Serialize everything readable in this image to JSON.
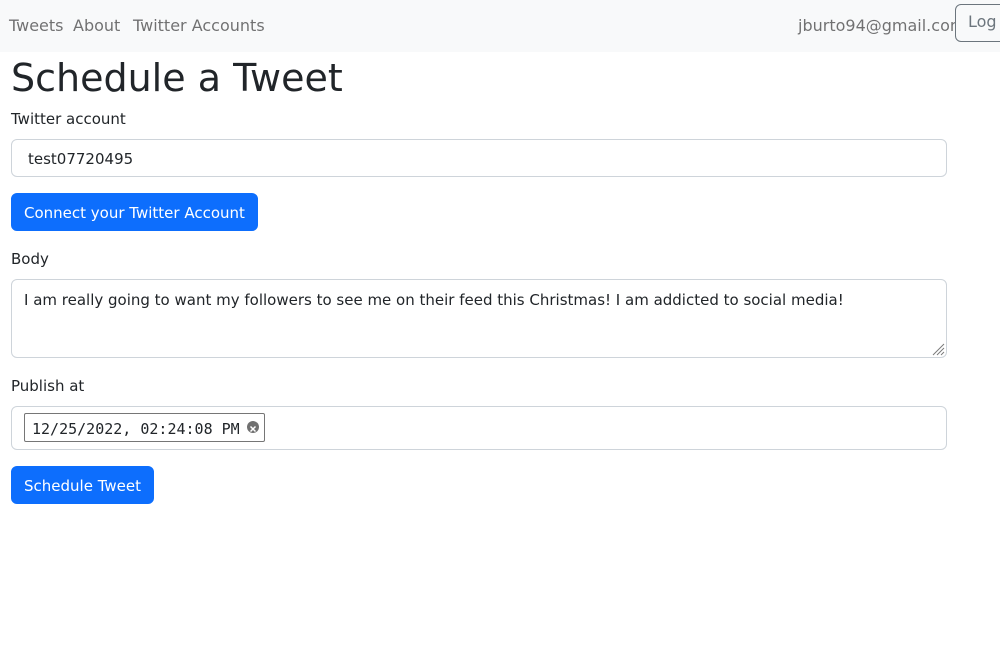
{
  "nav": {
    "links": [
      "Tweets",
      "About",
      "Twitter Accounts"
    ],
    "email": "jburto94@gmail.com",
    "logout_label": "Log"
  },
  "page": {
    "title": "Schedule a Tweet"
  },
  "form": {
    "twitter_account_label": "Twitter account",
    "twitter_account_value": "test07720495",
    "connect_button_label": "Connect your Twitter Account",
    "body_label": "Body",
    "body_value": "I am really going to want my followers to see me on their feed this Christmas! I am addicted to social media!",
    "publish_at_label": "Publish at",
    "publish_at_value": "12/25/2022, 02:24:08 PM",
    "submit_button_label": "Schedule Tweet"
  },
  "colors": {
    "primary": "#0d6efd",
    "navbar_bg": "#f8f9fa"
  },
  "icons": [
    "clear-icon",
    "resize-grip-icon"
  ]
}
